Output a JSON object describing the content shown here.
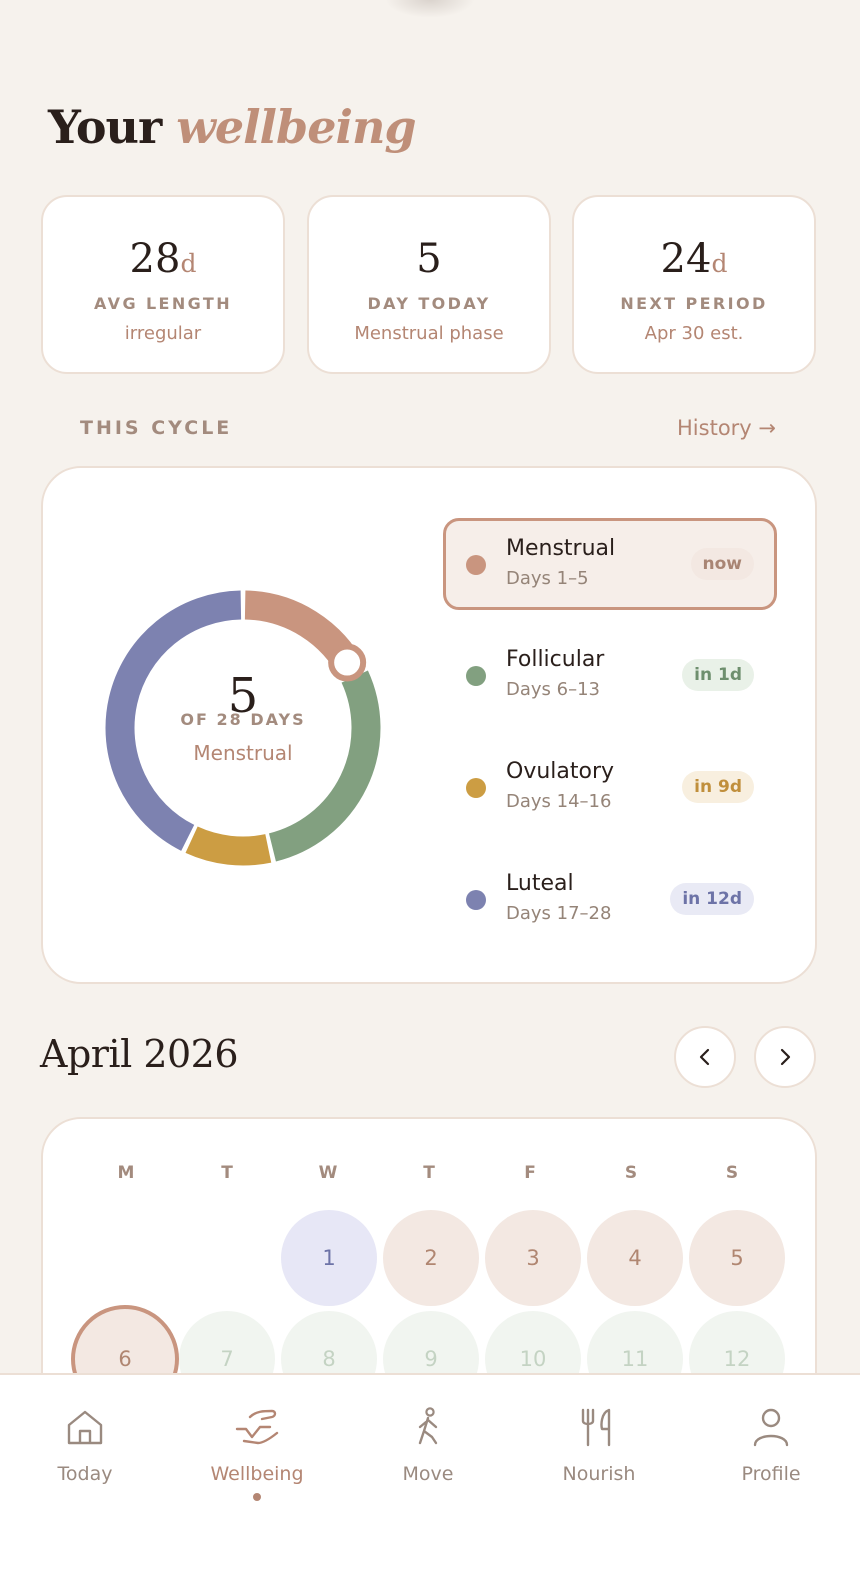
{
  "page": {
    "title_plain": "Your",
    "title_accent": "wellbeing"
  },
  "stats": [
    {
      "value": "28",
      "unit": "d",
      "label": "AVG LENGTH",
      "sub": "irregular"
    },
    {
      "value": "5",
      "unit": "",
      "label": "DAY TODAY",
      "sub": "Menstrual phase"
    },
    {
      "value": "24",
      "unit": "d",
      "label": "NEXT PERIOD",
      "sub": "Apr 30 est."
    }
  ],
  "cycle": {
    "section_label": "THIS CYCLE",
    "history_link": "History →",
    "current_day": "5",
    "of_total": "OF 28 DAYS",
    "current_phase": "Menstrual",
    "total_days": 28,
    "phases": [
      {
        "name": "Menstrual",
        "days": "Days 1–5",
        "badge": "now",
        "start": 1,
        "end": 5,
        "color": "#c9957f",
        "badge_bg": "#f3e8e2",
        "badge_fg": "#a98574",
        "current": true
      },
      {
        "name": "Follicular",
        "days": "Days 6–13",
        "badge": "in 1d",
        "start": 6,
        "end": 13,
        "color": "#82a080",
        "badge_bg": "#e9f1e8",
        "badge_fg": "#6e8f6e",
        "current": false
      },
      {
        "name": "Ovulatory",
        "days": "Days 14–16",
        "badge": "in 9d",
        "start": 14,
        "end": 16,
        "color": "#cc9d43",
        "badge_bg": "#f8efdf",
        "badge_fg": "#c08f3c",
        "current": false
      },
      {
        "name": "Luteal",
        "days": "Days 17–28",
        "badge": "in 12d",
        "start": 17,
        "end": 28,
        "color": "#7d82b0",
        "badge_bg": "#e9eaf5",
        "badge_fg": "#6d73a7",
        "current": false
      }
    ]
  },
  "calendar": {
    "month_title": "April 2026",
    "prev_icon": "chevron-left-icon",
    "next_icon": "chevron-right-icon",
    "weekdays": [
      "M",
      "T",
      "W",
      "T",
      "F",
      "S",
      "S"
    ],
    "rows": [
      [
        {
          "label": "",
          "phase": "none"
        },
        {
          "label": "",
          "phase": "none"
        },
        {
          "label": "1",
          "phase": "luteal"
        },
        {
          "label": "2",
          "phase": "menstrual"
        },
        {
          "label": "3",
          "phase": "menstrual"
        },
        {
          "label": "4",
          "phase": "menstrual"
        },
        {
          "label": "5",
          "phase": "menstrual"
        }
      ],
      [
        {
          "label": "6",
          "phase": "today"
        },
        {
          "label": "7",
          "phase": "follicular"
        },
        {
          "label": "8",
          "phase": "follicular"
        },
        {
          "label": "9",
          "phase": "follicular"
        },
        {
          "label": "10",
          "phase": "follicular"
        },
        {
          "label": "11",
          "phase": "follicular"
        },
        {
          "label": "12",
          "phase": "follicular"
        }
      ]
    ]
  },
  "tabs": [
    {
      "label": "Today",
      "icon": "home-icon",
      "active": false
    },
    {
      "label": "Wellbeing",
      "icon": "wellbeing-hands-icon",
      "active": true
    },
    {
      "label": "Move",
      "icon": "walking-figure-icon",
      "active": false
    },
    {
      "label": "Nourish",
      "icon": "fork-knife-icon",
      "active": false
    },
    {
      "label": "Profile",
      "icon": "person-icon",
      "active": false
    }
  ]
}
